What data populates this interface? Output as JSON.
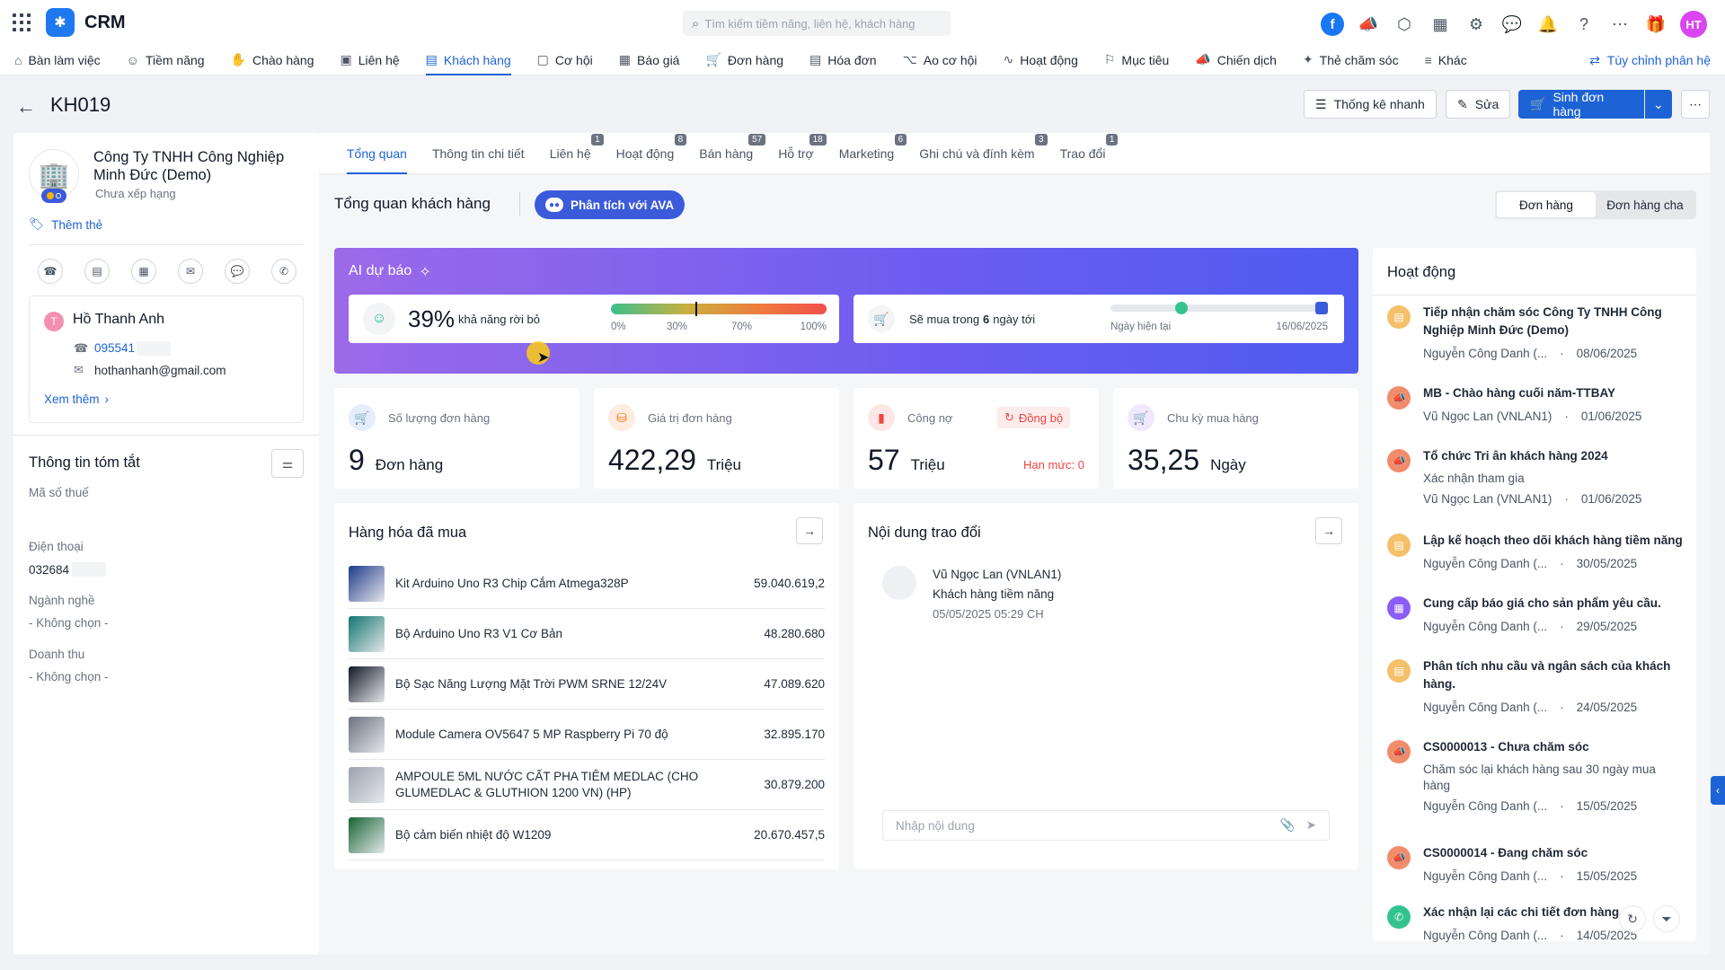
{
  "app": {
    "brand": "CRM",
    "search_placeholder": "Tìm kiếm tiềm năng, liên hệ, khách hàng",
    "user_initials": "HT"
  },
  "nav": {
    "items": [
      "Bàn làm việc",
      "Tiềm năng",
      "Chào hàng",
      "Liên hệ",
      "Khách hàng",
      "Cơ hội",
      "Báo giá",
      "Đơn hàng",
      "Hóa đơn",
      "Ao cơ hội",
      "Hoạt động",
      "Mục tiêu",
      "Chiến dịch",
      "Thẻ chăm sóc",
      "Khác"
    ],
    "active": "Khách hàng",
    "customize": "Tùy chỉnh phân hệ"
  },
  "header": {
    "title": "KH019",
    "quick_stats": "Thống kê nhanh",
    "edit": "Sửa",
    "create_order": "Sinh đơn hàng"
  },
  "profile": {
    "company": "Công Ty TNHH Công Nghiệp Minh Đức (Demo)",
    "rank": "Chưa xếp hạng",
    "add_tag": "Thêm thẻ",
    "contact_initial": "T",
    "contact_name": "Hồ Thanh Anh",
    "contact_phone": "095541",
    "contact_email": "hothanhanh@gmail.com",
    "see_more": "Xem thêm",
    "summary_title": "Thông tin tóm tắt",
    "tax_label": "Mã số thuế",
    "phone_label": "Điện thoại",
    "phone_value": "032684",
    "industry_label": "Ngành nghề",
    "industry_value": "- Không chọn -",
    "revenue_label": "Doanh thu",
    "revenue_value": "- Không chọn -"
  },
  "tabs": [
    {
      "label": "Tổng quan",
      "badge": ""
    },
    {
      "label": "Thông tin chi tiết",
      "badge": ""
    },
    {
      "label": "Liên hệ",
      "badge": "1"
    },
    {
      "label": "Hoạt động",
      "badge": "8"
    },
    {
      "label": "Bán hàng",
      "badge": "57"
    },
    {
      "label": "Hỗ trợ",
      "badge": "18"
    },
    {
      "label": "Marketing",
      "badge": "6"
    },
    {
      "label": "Ghi chú và đính kèm",
      "badge": "3"
    },
    {
      "label": "Trao đổi",
      "badge": "1"
    }
  ],
  "overview": {
    "title": "Tổng quan khách hàng",
    "ava_button": "Phân tích với AVA",
    "toggle": [
      "Đơn hàng",
      "Đơn hàng cha"
    ]
  },
  "ai": {
    "title": "AI dự báo",
    "churn_percent": "39%",
    "churn_value": 0.39,
    "churn_label": "khả năng rời bỏ",
    "churn_ticks": [
      "0%",
      "30%",
      "70%",
      "100%"
    ],
    "buy_prefix": "Sẽ mua trong",
    "buy_days": "6",
    "buy_suffix": "ngày tới",
    "today_label": "Ngày hiện tại",
    "target_date": "16/06/2025"
  },
  "stats": [
    {
      "label": "Số lượng đơn hàng",
      "value": "9",
      "unit": "Đơn hàng",
      "color": "#3b82f6"
    },
    {
      "label": "Giá trị đơn hàng",
      "value": "422,29",
      "unit": "Triệu",
      "color": "#f97316"
    },
    {
      "label": "Công nợ",
      "value": "57",
      "unit": "Triệu",
      "color": "#ef4444",
      "sync": "Đồng bộ",
      "limit": "Hạn mức: 0"
    },
    {
      "label": "Chu kỳ mua hàng",
      "value": "35,25",
      "unit": "Ngày",
      "color": "#8b5cf6"
    }
  ],
  "products": {
    "title": "Hàng hóa đã mua",
    "items": [
      {
        "name": "Kit Arduino Uno R3 Chip Cắm Atmega328P",
        "value": "59.040.619,2"
      },
      {
        "name": "Bộ Arduino Uno R3 V1 Cơ Bản",
        "value": "48.280.680"
      },
      {
        "name": "Bộ Sạc Năng Lượng Mặt Trời PWM SRNE 12/24V",
        "value": "47.089.620"
      },
      {
        "name": "Module Camera OV5647 5 MP Raspberry Pi 70 độ",
        "value": "32.895.170"
      },
      {
        "name": "AMPOULE 5ML NƯỚC CẤT PHA TIÊM MEDLAC (CHO GLUMEDLAC & GLUTHION 1200 VN) (HP)",
        "value": "30.879.200"
      },
      {
        "name": "Bộ cảm biến nhiệt độ W1209",
        "value": "20.670.457,5"
      }
    ]
  },
  "exchange": {
    "title": "Nội dung trao đổi",
    "author": "Vũ Ngọc Lan (VNLAN1)",
    "subject": "Khách hàng tiềm năng",
    "time": "05/05/2025 05:29 CH",
    "input_placeholder": "Nhập nội dung"
  },
  "activities": {
    "title": "Hoạt động",
    "items": [
      {
        "title": "Tiếp nhận chăm sóc Công Ty TNHH Công Nghiệp Minh Đức (Demo)",
        "sub": "",
        "person": "Nguyễn Công Danh (...",
        "date": "08/06/2025",
        "color": "#f4c06a"
      },
      {
        "title": "MB - Chào hàng cuối năm-TTBAY",
        "sub": "",
        "person": "Vũ Ngọc Lan (VNLAN1)",
        "date": "01/06/2025",
        "color": "#f28b6a"
      },
      {
        "title": "Tổ chức Tri ân khách hàng 2024",
        "sub": "Xác nhận tham gia",
        "person": "Vũ Ngọc Lan (VNLAN1)",
        "date": "01/06/2025",
        "color": "#f28b6a"
      },
      {
        "title": "Lập kế hoạch theo dõi khách hàng tiềm năng",
        "sub": "",
        "person": "Nguyễn Công Danh (...",
        "date": "30/05/2025",
        "color": "#f4c06a"
      },
      {
        "title": "Cung cấp báo giá cho sản phẩm yêu cầu.",
        "sub": "",
        "person": "Nguyễn Công Danh (...",
        "date": "29/05/2025",
        "color": "#8b5cf6"
      },
      {
        "title": "Phân tích nhu cầu và ngân sách của khách hàng.",
        "sub": "",
        "person": "Nguyễn Công Danh (...",
        "date": "24/05/2025",
        "color": "#f4c06a"
      },
      {
        "title": "CS0000013 - Chưa chăm sóc",
        "sub": "Chăm sóc lại khách hàng sau 30 ngày mua hàng",
        "person": "Nguyễn Công Danh (...",
        "date": "15/05/2025",
        "color": "#f28b6a"
      },
      {
        "title": "CS0000014 - Đang chăm sóc",
        "sub": "",
        "person": "Nguyễn Công Danh (...",
        "date": "15/05/2025",
        "color": "#f28b6a"
      },
      {
        "title": "Xác nhận lại các chi tiết đơn hàng.",
        "sub": "",
        "person": "Nguyễn Công Danh (...",
        "date": "14/05/2025",
        "color": "#34c38f"
      }
    ]
  }
}
